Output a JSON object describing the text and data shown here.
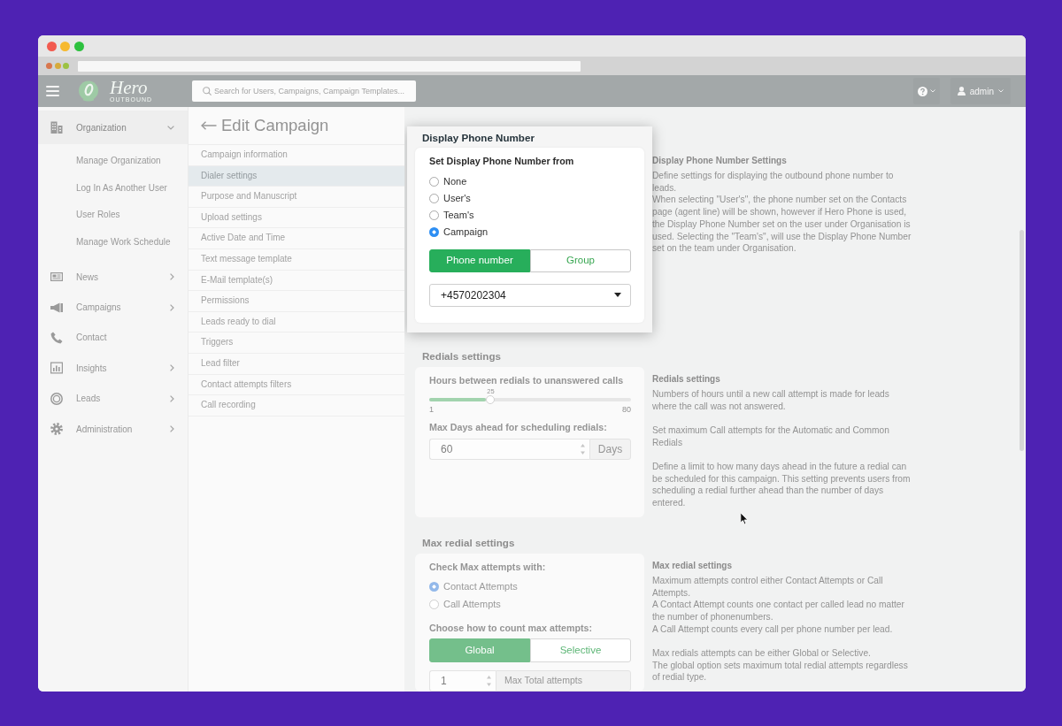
{
  "navbar": {
    "logo": {
      "name": "Hero",
      "tagline": "OUTBOUND"
    },
    "search": {
      "placeholder": "Search for Users, Campaigns, Campaign Templates..."
    },
    "user_menu": {
      "label": "admin"
    }
  },
  "sidebar": {
    "items": [
      {
        "label": "Organization",
        "kind": "group",
        "expanded": true,
        "children": [
          {
            "label": "Manage Organization"
          },
          {
            "label": "Log In As Another User"
          },
          {
            "label": "User Roles"
          },
          {
            "label": "Manage Work Schedule"
          }
        ]
      },
      {
        "label": "News",
        "kind": "group",
        "expanded": false
      },
      {
        "label": "Campaigns",
        "kind": "group",
        "expanded": false
      },
      {
        "label": "Contact",
        "kind": "link"
      },
      {
        "label": "Insights",
        "kind": "group",
        "expanded": false
      },
      {
        "label": "Leads",
        "kind": "group",
        "expanded": false
      },
      {
        "label": "Administration",
        "kind": "group",
        "expanded": false
      }
    ]
  },
  "edit_campaign": {
    "title": "Edit Campaign",
    "menu": [
      {
        "label": "Campaign information",
        "selected": false
      },
      {
        "label": "Dialer settings",
        "selected": true
      },
      {
        "label": "Purpose and Manuscript",
        "selected": false
      },
      {
        "label": "Upload settings",
        "selected": false
      },
      {
        "label": "Active Date and Time",
        "selected": false
      },
      {
        "label": "Text message template",
        "selected": false
      },
      {
        "label": "E-Mail template(s)",
        "selected": false
      },
      {
        "label": "Permissions",
        "selected": false
      },
      {
        "label": "Leads ready to dial",
        "selected": false
      },
      {
        "label": "Triggers",
        "selected": false
      },
      {
        "label": "Lead filter",
        "selected": false
      },
      {
        "label": "Contact attempts filters",
        "selected": false
      },
      {
        "label": "Call recording",
        "selected": false
      }
    ]
  },
  "sections": [
    {
      "kind": "display_phone",
      "title": "Display Phone Number",
      "focused": true,
      "source_label": "Set Display Phone Number from",
      "options": [
        {
          "label": "None",
          "selected": false
        },
        {
          "label": "User's",
          "selected": false
        },
        {
          "label": "Team's",
          "selected": false
        },
        {
          "label": "Campaign",
          "selected": true
        }
      ],
      "number_type": [
        {
          "label": "Phone number",
          "selected": true
        },
        {
          "label": "Group",
          "selected": false
        }
      ],
      "phone_number": {
        "value": "+4570202304"
      },
      "help": {
        "title": "Display Phone Number Settings",
        "groups": [
          [
            "Define settings for displaying the outbound phone number to leads.",
            "When selecting \"User's\", the phone number set on the Contacts page (agent line) will be shown, however if Hero Phone is used, the Display Phone Number set on the user under Organisation is used. Selecting the \"Team's\", will use the Display Phone Number set on the team under Organisation."
          ]
        ]
      }
    },
    {
      "kind": "redials",
      "title": "Redials settings",
      "focused": false,
      "hours": {
        "label": "Hours between redials to unanswered calls",
        "value": "25",
        "min": "1",
        "max": "80",
        "level": 0.304
      },
      "days": {
        "label": "Max Days ahead for scheduling redials:",
        "value": "60",
        "unit": "Days"
      },
      "help": {
        "title": "Redials settings",
        "groups": [
          [
            "Numbers of hours until a new call attempt is made for leads where the call was not answered."
          ],
          [
            "Set maximum Call attempts for the Automatic and Common Redials"
          ],
          [
            "Define a limit to how many days ahead in the future a redial can be scheduled for this campaign. This setting prevents users from scheduling a redial further ahead than the number of days entered."
          ]
        ]
      }
    },
    {
      "kind": "max_redial",
      "title": "Max redial settings",
      "focused": false,
      "check_label": "Check Max attempts with:",
      "options": [
        {
          "label": "Contact Attempts",
          "selected": true
        },
        {
          "label": "Call Attempts",
          "selected": false
        }
      ],
      "count_label": "Choose how to count max attempts:",
      "count_mode": [
        {
          "label": "Global",
          "selected": true
        },
        {
          "label": "Selective",
          "selected": false
        }
      ],
      "total": {
        "value": "1",
        "label": "Max Total attempts"
      },
      "help": {
        "title": "Max redial settings",
        "groups": [
          [
            "Maximum attempts control either Contact Attempts or Call Attempts.",
            "A Contact Attempt counts one contact per called lead no matter the number of phonenumbers.",
            "A Call Attempt counts every call per phone number per lead."
          ],
          [
            "Max redials attempts can be either Global or Selective.",
            "The global option sets maximum total redial attempts regardless of redial type."
          ]
        ]
      }
    }
  ]
}
